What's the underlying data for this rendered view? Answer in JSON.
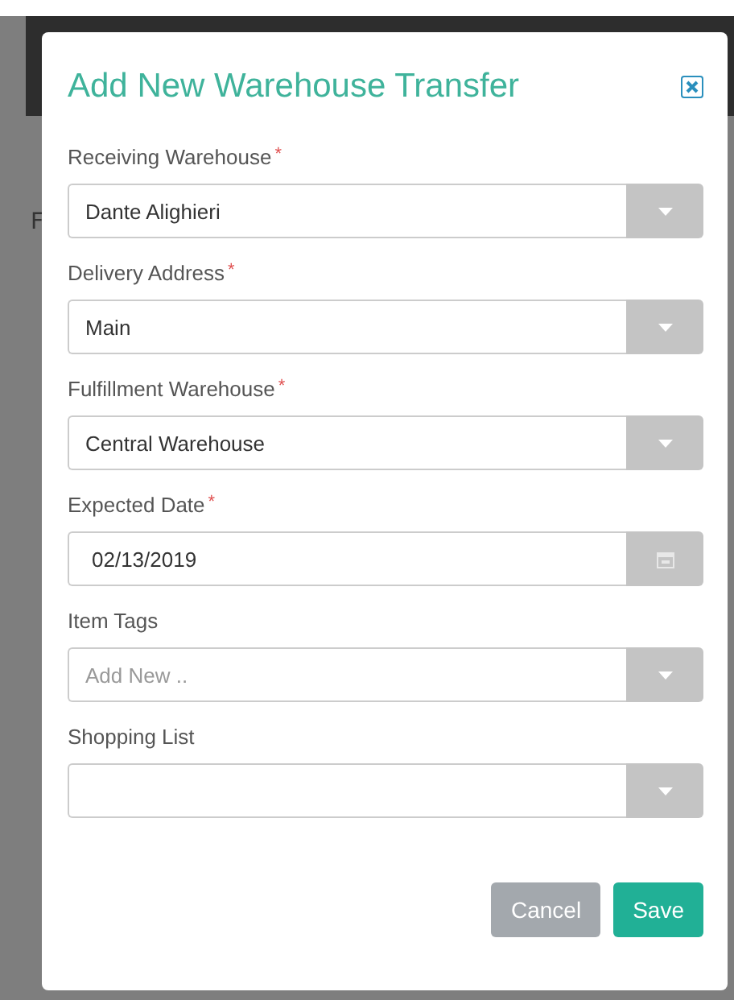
{
  "background": {
    "text_fragment": "F"
  },
  "dialog": {
    "title": "Add New Warehouse Transfer",
    "fields": [
      {
        "label": "Receiving Warehouse",
        "required_mark": "*",
        "kind": "select",
        "value": "Dante Alighieri"
      },
      {
        "label": "Delivery Address",
        "required_mark": "*",
        "kind": "select",
        "value": "Main"
      },
      {
        "label": "Fulfillment Warehouse",
        "required_mark": "*",
        "kind": "select",
        "value": "Central Warehouse"
      },
      {
        "label": "Expected Date",
        "required_mark": "*",
        "kind": "date",
        "value": "02/13/2019"
      },
      {
        "label": "Item Tags",
        "kind": "select",
        "placeholder": "Add New .."
      },
      {
        "label": "Shopping List",
        "kind": "select"
      }
    ],
    "buttons": [
      {
        "label": "Cancel",
        "kind": "secondary"
      },
      {
        "label": "Save",
        "kind": "primary"
      }
    ]
  }
}
